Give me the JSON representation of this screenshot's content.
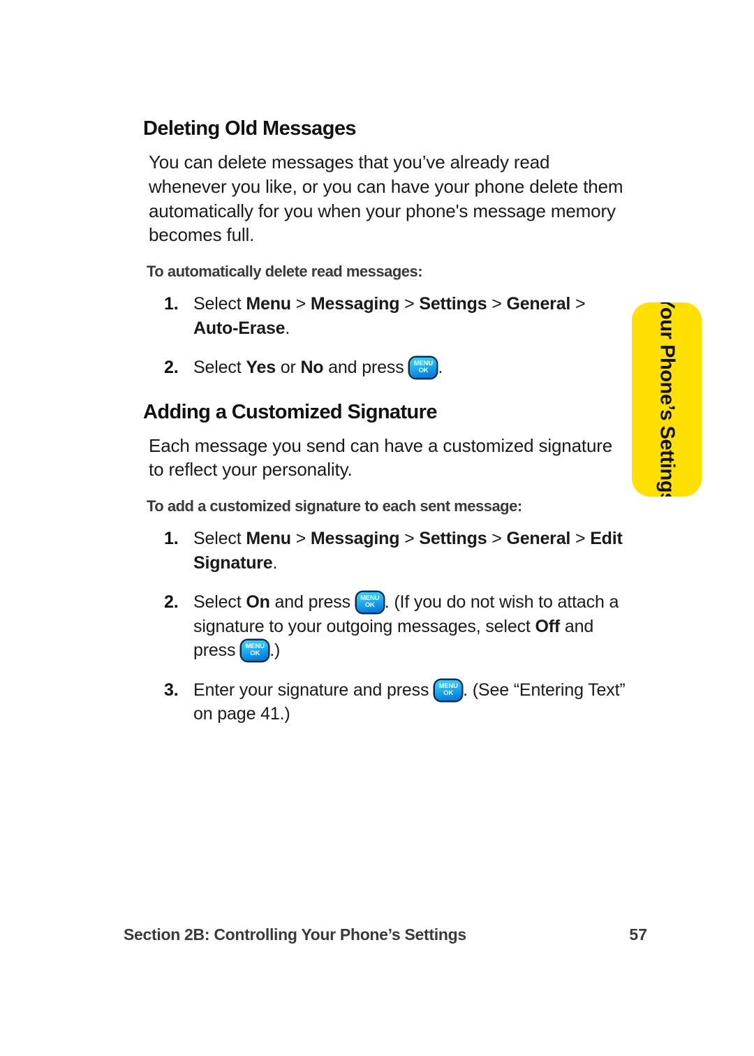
{
  "page": {
    "number": "57",
    "side_tab_label": "Your Phone’s Settings",
    "footer_section": "Section 2B: Controlling Your Phone’s Settings"
  },
  "sections": [
    {
      "heading": "Deleting Old Messages",
      "paragraph": "You can delete messages that you’ve already read whenever you like, or you can have your phone delete them automatically for you when your phone's message memory becomes full.",
      "subheading": "To automatically delete read messages:",
      "steps": [
        {
          "number": "1.",
          "parts": [
            {
              "text": "Select ",
              "bold": false
            },
            {
              "text": "Menu",
              "bold": true
            },
            {
              "text": " > ",
              "bold": false
            },
            {
              "text": "Messaging",
              "bold": true
            },
            {
              "text": " > ",
              "bold": false
            },
            {
              "text": "Settings",
              "bold": true
            },
            {
              "text": " > ",
              "bold": false
            },
            {
              "text": "General",
              "bold": true
            },
            {
              "text": " > ",
              "bold": false
            },
            {
              "text": "Auto-Erase",
              "bold": true
            },
            {
              "text": ".",
              "bold": false
            }
          ]
        },
        {
          "number": "2.",
          "parts": [
            {
              "text": "Select ",
              "bold": false
            },
            {
              "text": "Yes",
              "bold": true
            },
            {
              "text": " or ",
              "bold": false
            },
            {
              "text": "No",
              "bold": true
            },
            {
              "text": " and press ",
              "bold": false
            },
            {
              "icon": "menu-ok-key"
            },
            {
              "text": ".",
              "bold": false
            }
          ]
        }
      ]
    },
    {
      "heading": "Adding a Customized Signature",
      "paragraph": "Each message you send can have a customized signature to reflect your personality.",
      "subheading": "To add a customized signature to each sent message:",
      "steps": [
        {
          "number": "1.",
          "parts": [
            {
              "text": "Select ",
              "bold": false
            },
            {
              "text": "Menu",
              "bold": true
            },
            {
              "text": " > ",
              "bold": false
            },
            {
              "text": "Messaging",
              "bold": true
            },
            {
              "text": " > ",
              "bold": false
            },
            {
              "text": "Settings",
              "bold": true
            },
            {
              "text": " > ",
              "bold": false
            },
            {
              "text": "General",
              "bold": true
            },
            {
              "text": " > ",
              "bold": false
            },
            {
              "text": "Edit Signature",
              "bold": true
            },
            {
              "text": ".",
              "bold": false
            }
          ]
        },
        {
          "number": "2.",
          "parts": [
            {
              "text": "Select ",
              "bold": false
            },
            {
              "text": "On",
              "bold": true
            },
            {
              "text": " and press ",
              "bold": false
            },
            {
              "icon": "menu-ok-key"
            },
            {
              "text": ". (If you do not wish to attach a signature to your outgoing messages, select ",
              "bold": false
            },
            {
              "text": "Off",
              "bold": true
            },
            {
              "text": " and press ",
              "bold": false
            },
            {
              "icon": "menu-ok-key"
            },
            {
              "text": ".)",
              "bold": false
            }
          ]
        },
        {
          "number": "3.",
          "parts": [
            {
              "text": "Enter your signature and press ",
              "bold": false
            },
            {
              "icon": "menu-ok-key"
            },
            {
              "text": ". (See “Entering Text” on page 41.)",
              "bold": false
            }
          ]
        }
      ]
    }
  ],
  "icons": {
    "menu_ok_key": {
      "top_label": "MENU",
      "bottom_label": "OK",
      "color_top": "#3ad0fb",
      "color_bottom": "#0a6fd0",
      "border_color": "#0d2b4a"
    }
  },
  "colors": {
    "tab_yellow": "#ffe000",
    "text": "#1a1a1a",
    "subheading": "#3a3a3a"
  }
}
